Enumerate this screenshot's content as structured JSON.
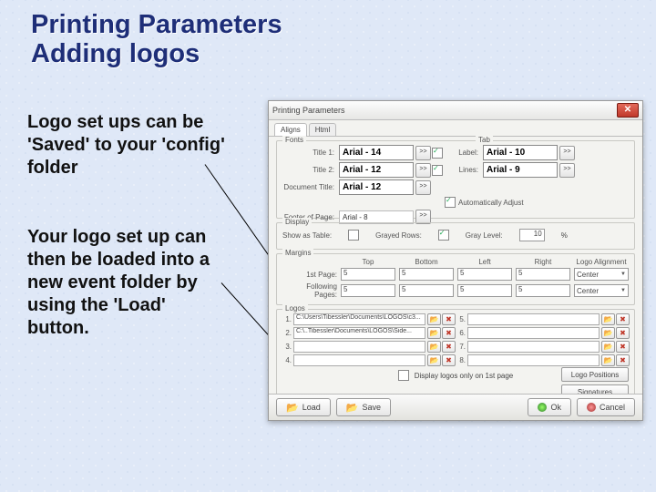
{
  "slide": {
    "title_line1": "Printing Parameters",
    "title_line2": "Adding logos",
    "para1": "Logo set ups can be 'Saved' to your 'config' folder",
    "para2": "Your logo set up can then be loaded into a new event folder by using the 'Load' button."
  },
  "dialog": {
    "title": "Printing Parameters",
    "tabs": {
      "aligns": "Aligns",
      "html": "Html"
    },
    "fonts": {
      "group": "Fonts",
      "tab_group": "Tab",
      "title1_label": "Title 1:",
      "title1_font": "Arial - 14",
      "title2_label": "Title 2:",
      "title2_font": "Arial - 12",
      "doctitle_label": "Document Title:",
      "doctitle_font": "Arial - 12",
      "footer_label": "Footer of Page:",
      "footer_font": "Arial - 8",
      "tab_label_label": "Label:",
      "tab_label_font": "Arial - 10",
      "tab_lines_label": "Lines:",
      "tab_lines_font": "Arial - 9",
      "auto_adjust": "Automatically Adjust"
    },
    "display": {
      "group": "Display",
      "show_as_table": "Show as Table:",
      "grayed_rows": "Grayed Rows:",
      "gray_level": "Gray Level:",
      "gray_level_value": "10",
      "pct": "%"
    },
    "margins": {
      "group": "Margins",
      "cols": {
        "top": "Top",
        "bottom": "Bottom",
        "left": "Left",
        "right": "Right",
        "align": "Logo Alignment"
      },
      "rows": {
        "first": {
          "label": "1st Page:",
          "top": "5",
          "bottom": "5",
          "left": "5",
          "right": "5",
          "align": "Center"
        },
        "following": {
          "label": "Following Pages:",
          "top": "5",
          "bottom": "5",
          "left": "5",
          "right": "5",
          "align": "Center"
        }
      }
    },
    "logos": {
      "group": "Logos",
      "rows": {
        "1": "C:\\Users\\Tibessler\\Documents\\LOGOS\\c3...",
        "2": "C:\\..Tibessler\\Documents\\LOGOS\\Side...",
        "3": "",
        "4": "",
        "5": "",
        "6": "",
        "7": "",
        "8": ""
      },
      "first_page_only": "Display logos only on 1st page",
      "positions_btn": "Logo Positions",
      "signatures_btn": "Signatures"
    },
    "buttons": {
      "load": "Load",
      "save": "Save",
      "ok": "Ok",
      "cancel": "Cancel"
    }
  }
}
